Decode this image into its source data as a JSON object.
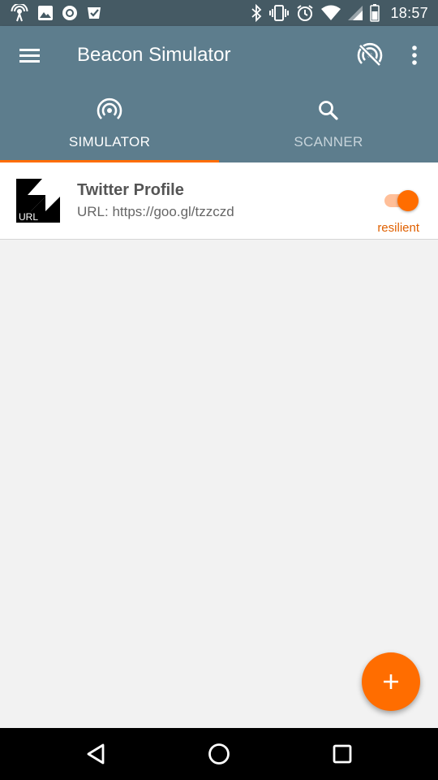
{
  "status_bar": {
    "time": "18:57",
    "left_icons": [
      "beacon-notification-icon",
      "image-notification-icon",
      "record-notification-icon",
      "store-notification-icon"
    ],
    "right_icons": [
      "bluetooth-icon",
      "vibrate-icon",
      "alarm-icon",
      "wifi-icon",
      "cellular-icon",
      "battery-icon"
    ]
  },
  "app_bar": {
    "title": "Beacon Simulator",
    "actions": [
      "broadcast-off-icon",
      "more-vert-icon"
    ]
  },
  "tabs": [
    {
      "label": "SIMULATOR",
      "icon": "broadcast-icon",
      "active": true
    },
    {
      "label": "SCANNER",
      "icon": "search-icon",
      "active": false
    }
  ],
  "beacons": [
    {
      "title": "Twitter Profile",
      "subtitle": "URL: https://goo.gl/tzzczd",
      "logo_text": "URL",
      "mode": "resilient",
      "enabled": true
    }
  ],
  "fab": {
    "icon": "add-icon"
  },
  "nav_bar": {
    "icons": [
      "back-icon",
      "home-icon",
      "recents-icon"
    ]
  },
  "colors": {
    "status_bar": "#455a64",
    "app_bar": "#5d7d8d",
    "accent": "#ff6d00",
    "background": "#f2f2f2"
  }
}
